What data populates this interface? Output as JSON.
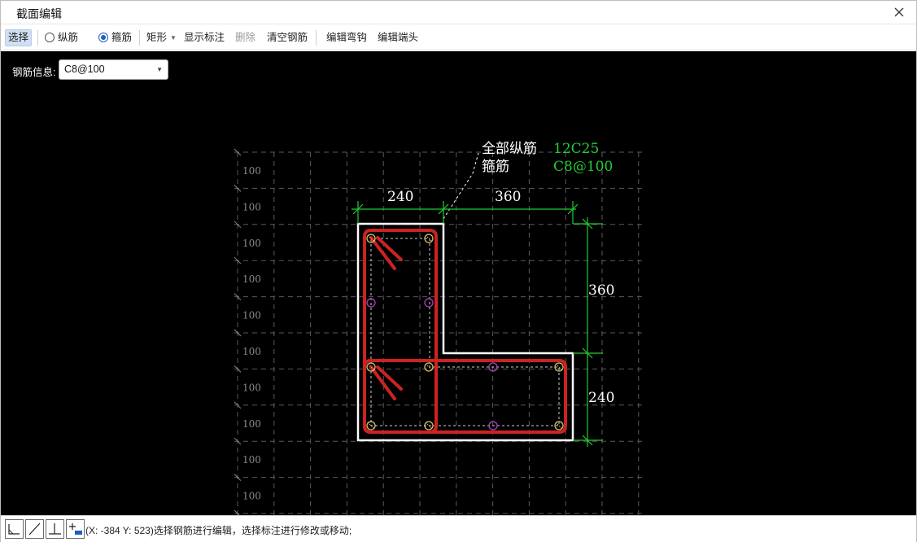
{
  "window": {
    "title": "截面编辑"
  },
  "toolbar": {
    "select": "选择",
    "longitudinal": "纵筋",
    "stirrup": "箍筋",
    "rectangle": "矩形",
    "show_dim": "显示标注",
    "delete": "删除",
    "clear_rebar": "清空钢筋",
    "edit_hook": "编辑弯钩",
    "edit_end": "编辑端头"
  },
  "rebar_info": {
    "label": "钢筋信息:",
    "value": "C8@100"
  },
  "annotation": {
    "all_longitudinal_label": "全部纵筋",
    "all_longitudinal_value": "12C25",
    "stirrup_label": "箍筋",
    "stirrup_value": "C8@100"
  },
  "dimensions": {
    "top_left": "240",
    "top_right": "360",
    "right_top": "360",
    "right_bottom": "240"
  },
  "grid": {
    "row_label": "100"
  },
  "colors": {
    "canvas_bg": "#000000",
    "outline": "#ffffff",
    "stirrup": "#cc2222",
    "dimension": "#22cc33",
    "grid": "#5a5a5a",
    "corner_bar": "#d8c06a",
    "mid_bar": "#b040c0"
  },
  "status": {
    "tools": [
      "corner-tool-icon",
      "line-tool-icon",
      "perpendicular-tool-icon",
      "add-point-tool-icon"
    ],
    "message": "(X: -384 Y: 523)选择钢筋进行编辑，选择标注进行修改或移动;"
  }
}
